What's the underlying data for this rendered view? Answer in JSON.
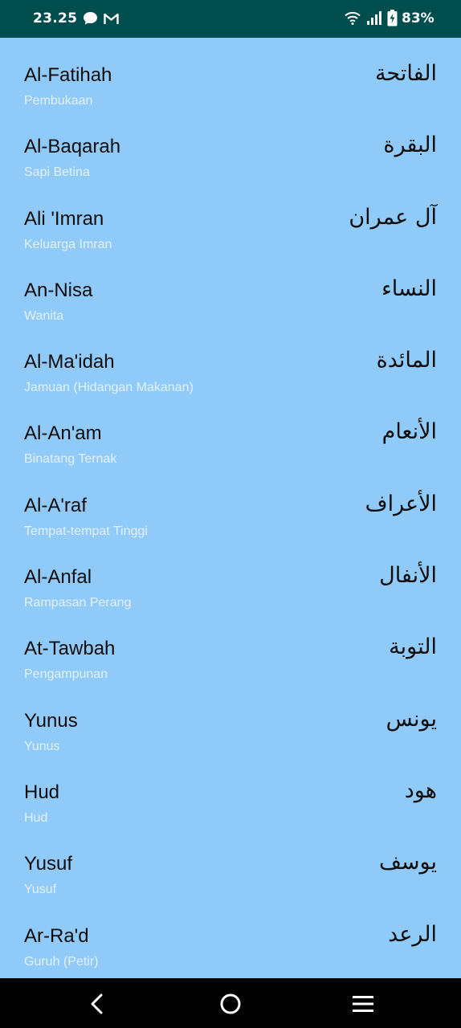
{
  "status_bar": {
    "time": "23.25",
    "battery": "83%",
    "icons": [
      "chat-icon",
      "gmail-icon",
      "wifi-icon",
      "signal-icon",
      "battery-icon"
    ]
  },
  "surahs": [
    {
      "latin": "Al-Fatihah",
      "meaning": "Pembukaan",
      "arabic": "الفاتحة"
    },
    {
      "latin": "Al-Baqarah",
      "meaning": "Sapi Betina",
      "arabic": "البقرة"
    },
    {
      "latin": "Ali 'Imran",
      "meaning": "Keluarga Imran",
      "arabic": "آل عمران"
    },
    {
      "latin": "An-Nisa",
      "meaning": "Wanita",
      "arabic": "النساء"
    },
    {
      "latin": "Al-Ma'idah",
      "meaning": "Jamuan (Hidangan Makanan)",
      "arabic": "المائدة"
    },
    {
      "latin": "Al-An'am",
      "meaning": "Binatang Ternak",
      "arabic": "الأنعام"
    },
    {
      "latin": "Al-A'raf",
      "meaning": "Tempat-tempat Tinggi",
      "arabic": "الأعراف"
    },
    {
      "latin": "Al-Anfal",
      "meaning": "Rampasan Perang",
      "arabic": "الأنفال"
    },
    {
      "latin": "At-Tawbah",
      "meaning": "Pengampunan",
      "arabic": "التوبة"
    },
    {
      "latin": "Yunus",
      "meaning": "Yunus",
      "arabic": "يونس"
    },
    {
      "latin": "Hud",
      "meaning": "Hud",
      "arabic": "هود"
    },
    {
      "latin": "Yusuf",
      "meaning": "Yusuf",
      "arabic": "يوسف"
    },
    {
      "latin": "Ar-Ra'd",
      "meaning": "Guruh (Petir)",
      "arabic": "الرعد"
    }
  ],
  "nav_bar": {
    "buttons": [
      "back-icon",
      "home-icon",
      "menu-icon"
    ]
  },
  "colors": {
    "status_bar_bg": "#004D4D",
    "list_bg": "#90CAF9",
    "meaning_text": "#E3F2FD",
    "nav_bar_bg": "#000000"
  }
}
